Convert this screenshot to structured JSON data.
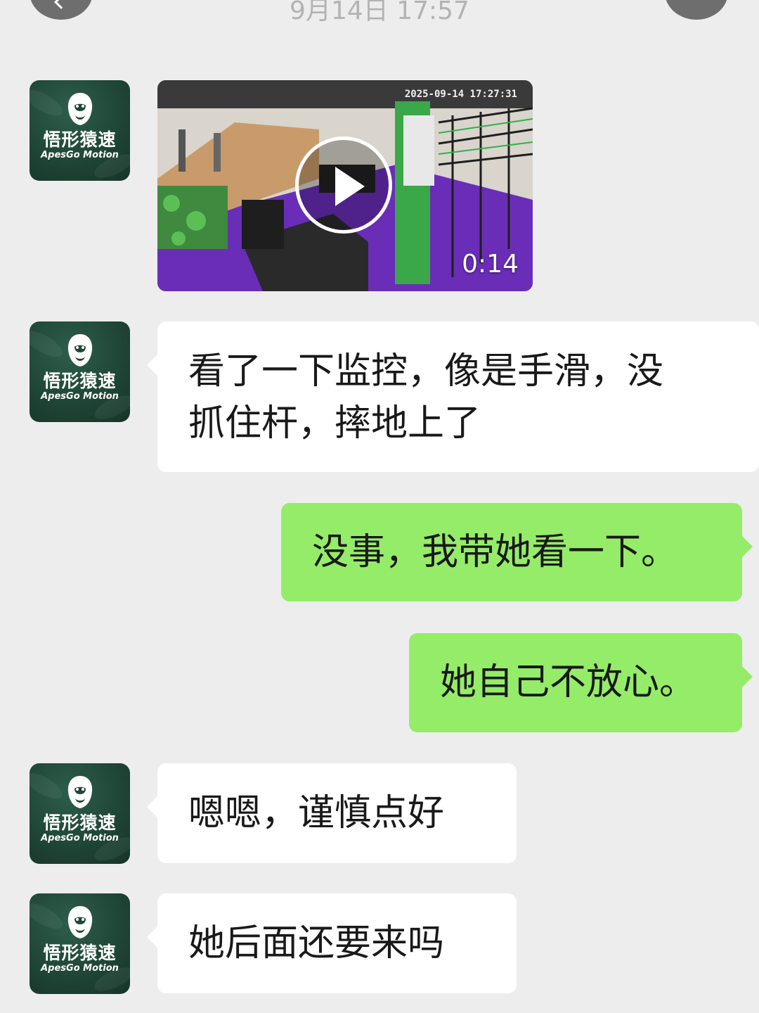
{
  "header": {
    "timestamp": "9月14日 17:57"
  },
  "contact": {
    "brand_cn": "悟形猿速",
    "brand_en": "ApesGo Motion",
    "avatar_icon": "gorilla-logo-icon"
  },
  "video_message": {
    "camera_timestamp": "2025-09-14 17:27:31",
    "duration": "0:14"
  },
  "messages": [
    {
      "side": "in",
      "text_lines": [
        "看了一下监控，像是手滑，没",
        "抓住杆，摔地上了"
      ]
    },
    {
      "side": "out",
      "text": "没事，我带她看一下。"
    },
    {
      "side": "out",
      "text": "她自己不放心。"
    },
    {
      "side": "in",
      "text": "嗯嗯，谨慎点好"
    },
    {
      "side": "in",
      "text": "她后面还要来吗"
    }
  ],
  "colors": {
    "background": "#ededed",
    "incoming_bubble": "#ffffff",
    "outgoing_bubble": "#95ec69",
    "avatar_green": "#1f4637",
    "gym_floor_purple": "#6a2db8",
    "gym_accent_green": "#3aa848"
  }
}
